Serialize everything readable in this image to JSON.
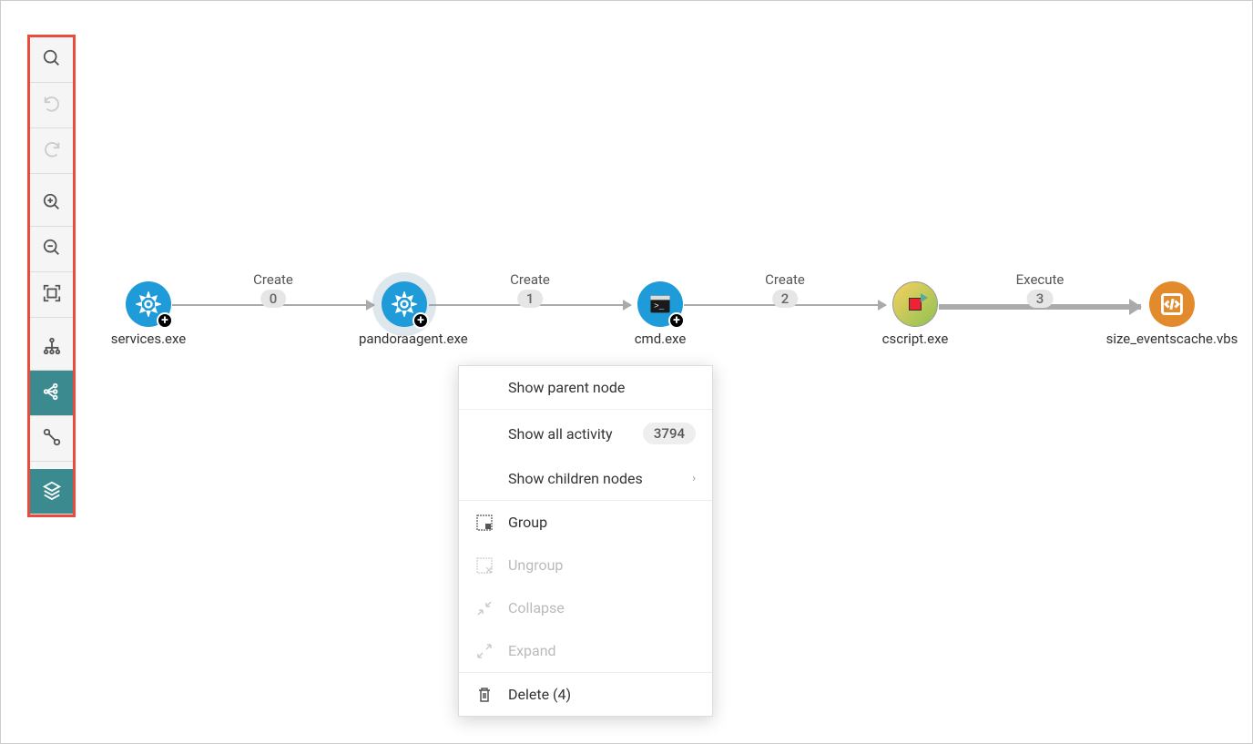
{
  "toolbar": {
    "search": "search",
    "undo": "undo",
    "redo": "redo",
    "zoom_in": "zoom-in",
    "zoom_out": "zoom-out",
    "fit": "fit-screen",
    "tree": "tree-layout",
    "graph": "graph-layout",
    "link": "link-layout",
    "layers": "layers"
  },
  "nodes": [
    {
      "label": "services.exe",
      "type": "gear",
      "badge": "plus"
    },
    {
      "label": "pandoraagent.exe",
      "type": "gear",
      "badge": "plus",
      "highlighted": true
    },
    {
      "label": "cmd.exe",
      "type": "cmd",
      "badge": "plus"
    },
    {
      "label": "cscript.exe",
      "type": "script",
      "badge": null
    },
    {
      "label": "size_eventscache.vbs",
      "type": "code",
      "badge": null
    }
  ],
  "edges": [
    {
      "label": "Create",
      "seq": "0",
      "thick": false
    },
    {
      "label": "Create",
      "seq": "1",
      "thick": false
    },
    {
      "label": "Create",
      "seq": "2",
      "thick": false
    },
    {
      "label": "Execute",
      "seq": "3",
      "thick": true
    }
  ],
  "context_menu": {
    "show_parent": "Show parent node",
    "show_all_activity": "Show all activity",
    "activity_count": "3794",
    "show_children": "Show children nodes",
    "group": "Group",
    "ungroup": "Ungroup",
    "collapse": "Collapse",
    "expand": "Expand",
    "delete": "Delete (4)"
  }
}
